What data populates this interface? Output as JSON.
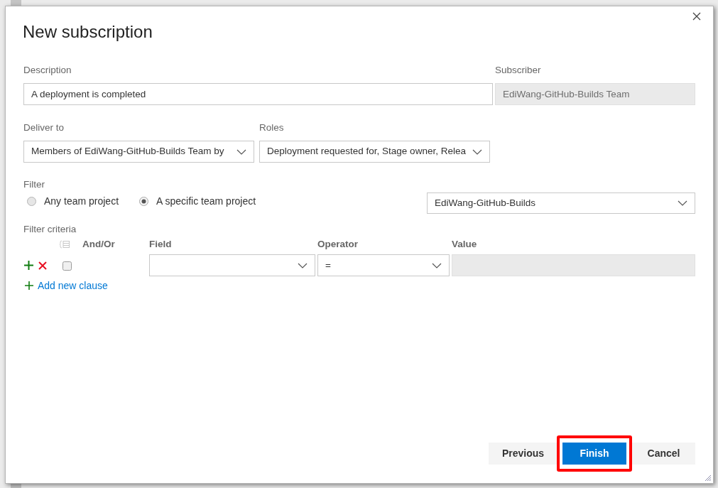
{
  "dialog": {
    "title": "New subscription",
    "description": {
      "label": "Description",
      "value": "A deployment is completed"
    },
    "subscriber": {
      "label": "Subscriber",
      "value": "EdiWang-GitHub-Builds Team",
      "disabled": true
    },
    "deliver_to": {
      "label": "Deliver to",
      "value": "Members of EdiWang-GitHub-Builds Team by"
    },
    "roles": {
      "label": "Roles",
      "value": "Deployment requested for, Stage owner, Relea"
    },
    "filter": {
      "label": "Filter",
      "options": [
        {
          "label": "Any team project",
          "selected": false
        },
        {
          "label": "A specific team project",
          "selected": true
        }
      ],
      "project": {
        "value": "EdiWang-GitHub-Builds"
      }
    },
    "filter_criteria": {
      "label": "Filter criteria",
      "group_button": {
        "disabled": true
      },
      "columns": [
        "And/Or",
        "Field",
        "Operator",
        "Value"
      ],
      "clauses": [
        {
          "checked": false,
          "operator": "=",
          "value_disabled": true
        }
      ],
      "add_clause": {
        "label": "Add new clause"
      }
    },
    "buttons": [
      {
        "label": "Previous",
        "kind": "secondary",
        "highlighted": false
      },
      {
        "label": "Finish",
        "kind": "primary",
        "highlighted": true
      },
      {
        "label": "Cancel",
        "kind": "secondary",
        "highlighted": false
      }
    ]
  }
}
